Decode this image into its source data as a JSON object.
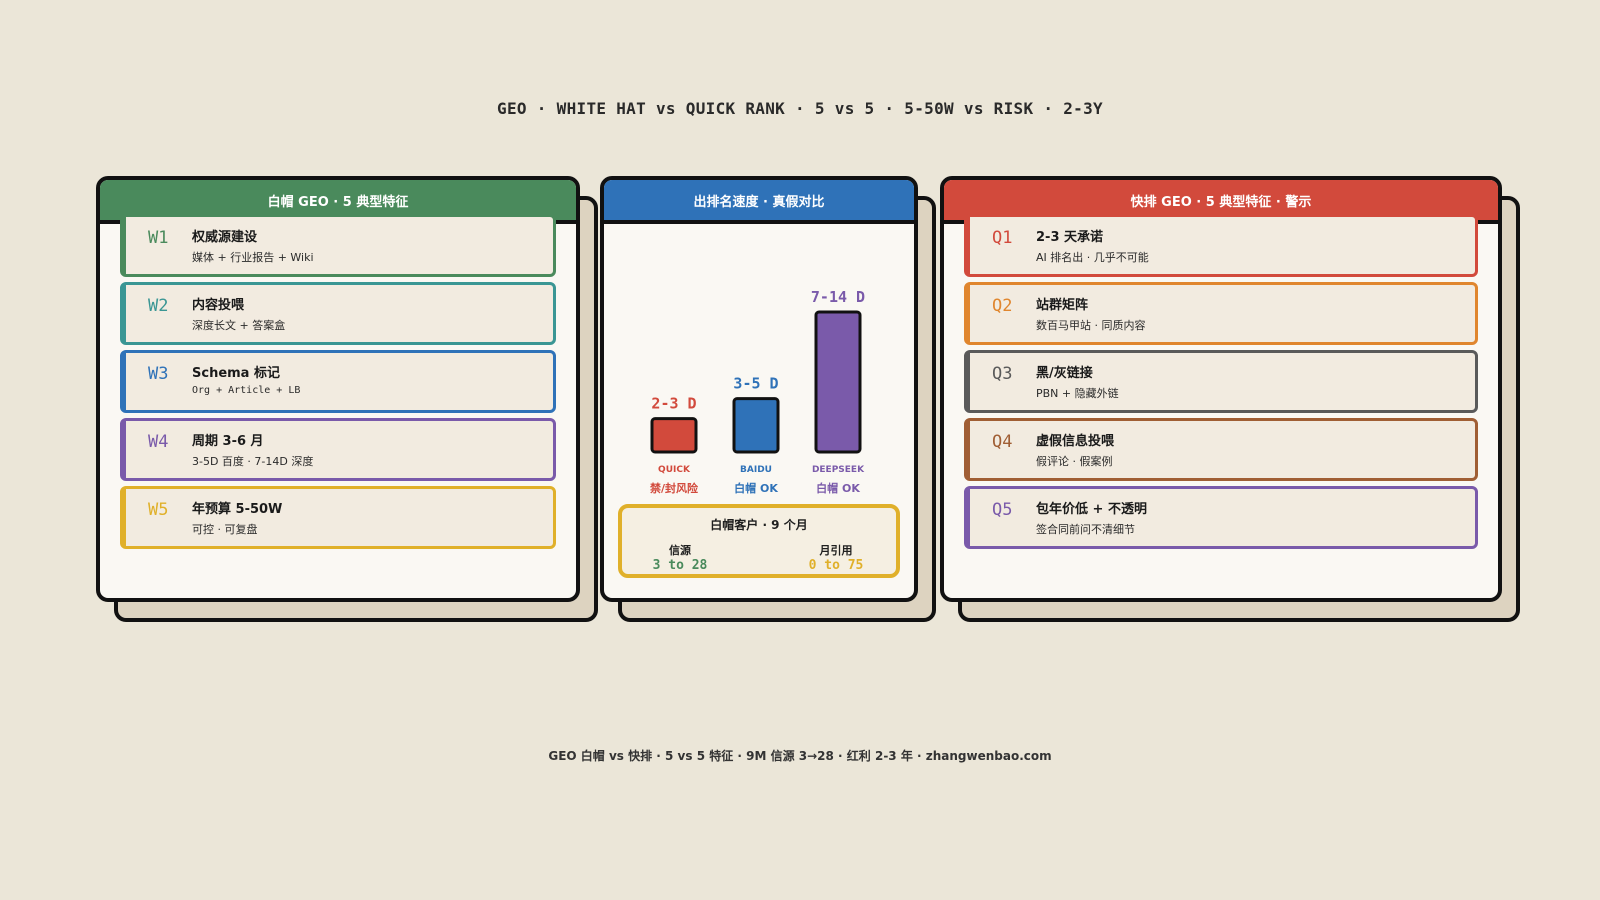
{
  "title": "GEO · WHITE HAT vs QUICK RANK · 5 vs 5 · 5-50W vs RISK · 2-3Y",
  "footer": "GEO 白帽 vs 快排 · 5 vs 5 特征 · 9M 信源 3→28 · 红利 2-3 年 · zhangwenbao.com",
  "colors": {
    "background": "#ebe6d8",
    "green": "#4a8a5c",
    "blue": "#2f72b8",
    "red": "#d24a3c",
    "purple": "#7a5aaa",
    "orange": "#e0862e",
    "teal": "#3a9694",
    "gold": "#e0b02a",
    "gray": "#5a5a5a",
    "brown": "#a05e34"
  },
  "white_hat": {
    "header": "白帽 GEO · 5 典型特征",
    "items": [
      {
        "code": "W1",
        "title": "权威源建设",
        "sub": "媒体 + 行业报告 + Wiki",
        "color": "#4a8a5c"
      },
      {
        "code": "W2",
        "title": "内容投喂",
        "sub": "深度长文 + 答案盒",
        "color": "#3a9694"
      },
      {
        "code": "W3",
        "title": "Schema 标记",
        "sub": "Org + Article + LB",
        "color": "#2f72b8"
      },
      {
        "code": "W4",
        "title": "周期 3-6 月",
        "sub": "3-5D 百度 · 7-14D 深度",
        "color": "#7a5aaa"
      },
      {
        "code": "W5",
        "title": "年预算 5-50W",
        "sub": "可控 · 可复盘",
        "color": "#e0b02a"
      }
    ]
  },
  "speed": {
    "header": "出排名速度 · 真假对比",
    "mini": {
      "title": "白帽客户 · 9 个月",
      "left_label": "信源",
      "left_value": "3 to 28",
      "right_label": "月引用",
      "right_value": "0 to 75"
    }
  },
  "chart_data": {
    "type": "bar",
    "categories": [
      "QUICK",
      "BAIDU",
      "DEEPSEEK"
    ],
    "values": [
      2.5,
      4,
      10.5
    ],
    "value_labels": [
      "2-3 D",
      "3-5 D",
      "7-14 D"
    ],
    "status_labels": [
      "禁/封风险",
      "白帽 OK",
      "白帽 OK"
    ],
    "colors": [
      "#d24a3c",
      "#2f72b8",
      "#7a5aaa"
    ],
    "ylim": [
      0,
      12
    ]
  },
  "quick_rank": {
    "header": "快排 GEO · 5 典型特征 · 警示",
    "items": [
      {
        "code": "Q1",
        "title": "2-3 天承诺",
        "sub": "AI 排名出 · 几乎不可能",
        "color": "#d24a3c"
      },
      {
        "code": "Q2",
        "title": "站群矩阵",
        "sub": "数百马甲站 · 同质内容",
        "color": "#e0862e"
      },
      {
        "code": "Q3",
        "title": "黑/灰链接",
        "sub": "PBN + 隐藏外链",
        "color": "#5a5a5a"
      },
      {
        "code": "Q4",
        "title": "虚假信息投喂",
        "sub": "假评论 · 假案例",
        "color": "#a05e34"
      },
      {
        "code": "Q5",
        "title": "包年价低 + 不透明",
        "sub": "签合同前问不清细节",
        "color": "#7a5aaa"
      }
    ]
  }
}
